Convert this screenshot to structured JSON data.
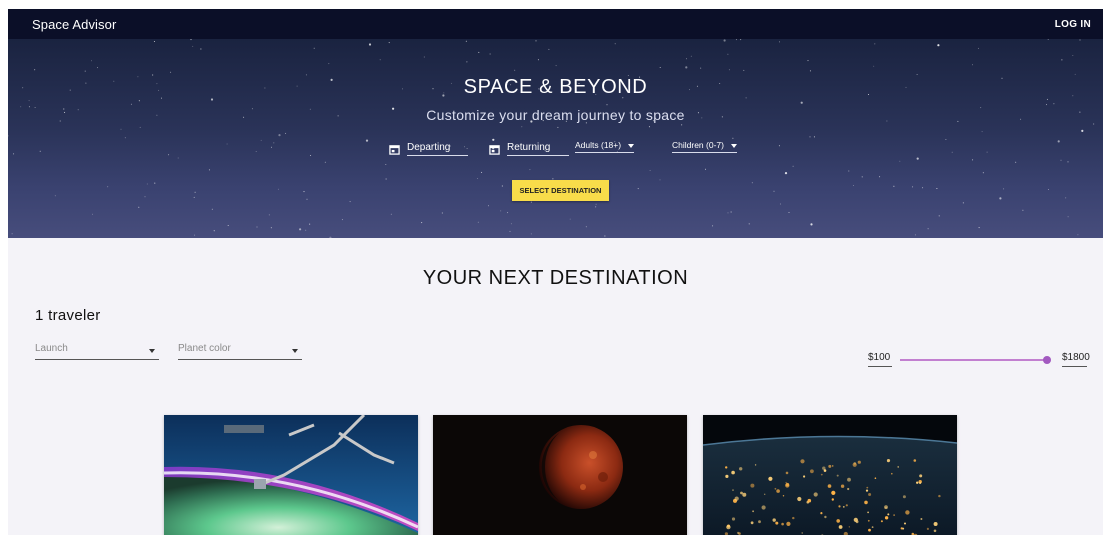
{
  "app": {
    "title": "Space Advisor",
    "login_label": "LOG IN"
  },
  "hero": {
    "title": "SPACE & BEYOND",
    "subtitle": "Customize your dream journey to space",
    "departing_label": "Departing",
    "returning_label": "Returning",
    "adults_label": "Adults (18+)",
    "children_label": "Children (0-7)",
    "select_button": "SELECT DESTINATION"
  },
  "destinations": {
    "section_title": "YOUR NEXT DESTINATION",
    "travelers_label": "1 traveler",
    "filters": {
      "launch_placeholder": "Launch",
      "planet_color_placeholder": "Planet color"
    },
    "price_range": {
      "min_label": "$100",
      "max_label": "$1800",
      "min": 100,
      "max": 1800
    },
    "cards": [
      {
        "image": "aurora-over-earth-from-station"
      },
      {
        "image": "red-planet-crescent"
      },
      {
        "image": "earth-city-lights-at-night"
      }
    ]
  },
  "icons": {
    "calendar": "calendar-icon",
    "dropdown": "chevron-down-icon"
  },
  "colors": {
    "appbar": "#0b0f28",
    "accent_button": "#f8dc4a",
    "slider": "#a259c0",
    "background": "#f4f3f8"
  }
}
